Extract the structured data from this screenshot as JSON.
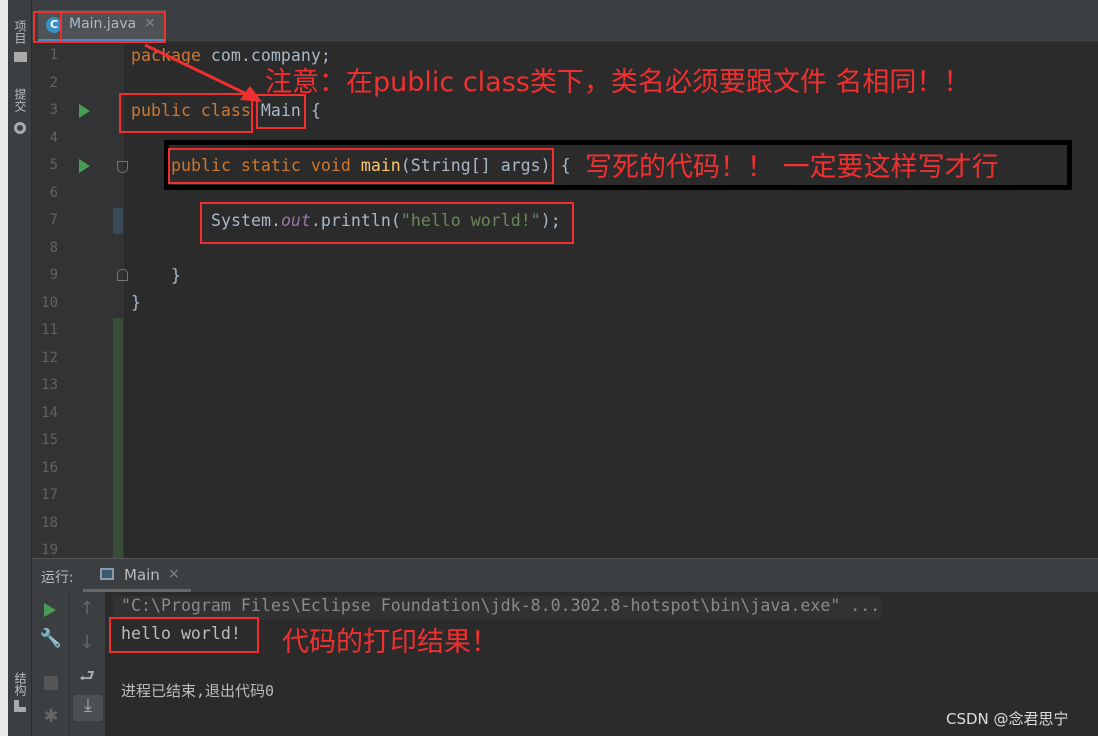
{
  "sidebar": {
    "project_label": "项目",
    "commit_label": "提交",
    "structure_label": "结构"
  },
  "editor": {
    "tab": {
      "icon": "C",
      "label": "Main.java",
      "close": "×"
    },
    "line_numbers": [
      "1",
      "2",
      "3",
      "4",
      "5",
      "6",
      "7",
      "8",
      "9",
      "10",
      "11",
      "12",
      "13",
      "14",
      "15",
      "16",
      "17",
      "18",
      "19"
    ],
    "code": {
      "l1_kw": "package",
      "l1_rest": " com.company;",
      "l3_kw": "public class",
      "l3_name": "Main",
      "l3_rest": " {",
      "l5_kw": "public static void",
      "l5_fn": "main",
      "l5_rest": "(String[] args) {",
      "l7_a": "System.",
      "l7_out": "out",
      "l7_b": ".println(",
      "l7_str": "\"hello world!\"",
      "l7_c": ");",
      "l9": "}",
      "l10": "}"
    }
  },
  "annotations": {
    "class_note": "注意：在public class类下，类名必须要跟文件     名相同！！",
    "main_note": "写死的代码！！ 一定要这样写才行",
    "output_note": "代码的打印结果！"
  },
  "run_panel": {
    "label": "运行:",
    "tab_label": "Main",
    "tab_close": "×",
    "command": "\"C:\\Program Files\\Eclipse Foundation\\jdk-8.0.302.8-hotspot\\bin\\java.exe\" ...",
    "output": "hello world!",
    "exit_message": "进程已结束,退出代码0"
  },
  "watermark": "CSDN @念君思宁",
  "colors": {
    "annotation": "#f03030",
    "keyword": "#cc7832",
    "function": "#ffc66d",
    "string": "#6a8759"
  }
}
